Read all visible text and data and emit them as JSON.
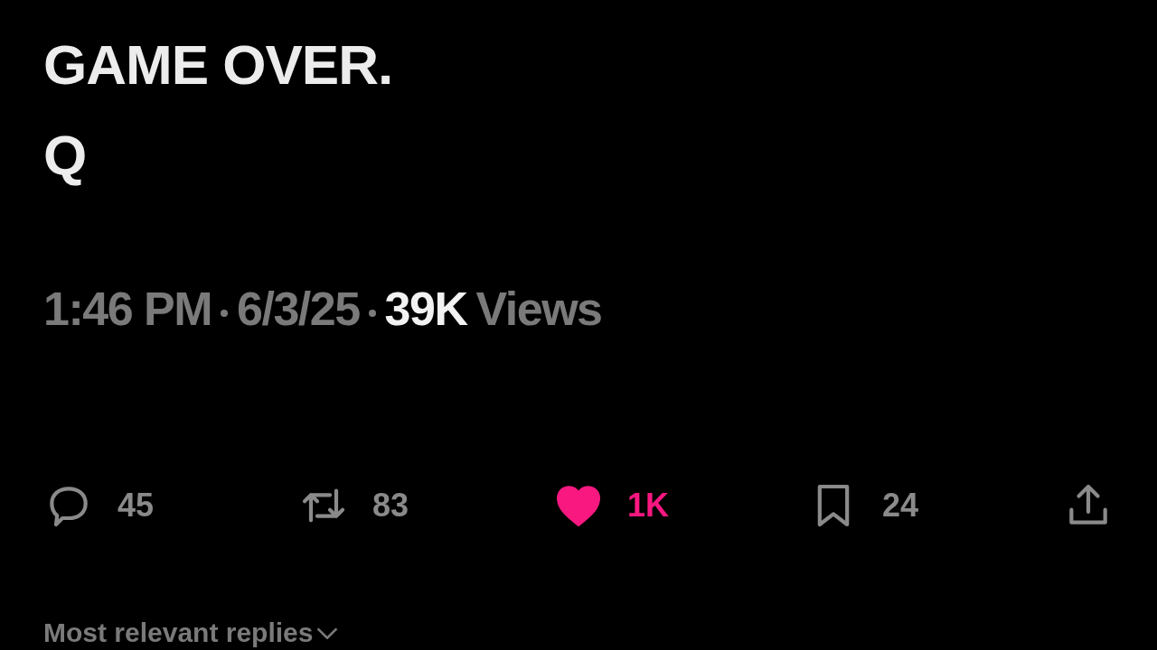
{
  "post": {
    "text_lines": [
      "GAME OVER.",
      "Q"
    ]
  },
  "meta": {
    "time": "1:46 PM",
    "date": "6/3/25",
    "views_count": "39K",
    "views_label": "Views"
  },
  "actions": [
    {
      "kind": "reply",
      "count": "45",
      "active": false
    },
    {
      "kind": "repost",
      "count": "83",
      "active": false
    },
    {
      "kind": "like",
      "count": "1K",
      "active": true
    },
    {
      "kind": "bookmark",
      "count": "24",
      "active": false
    },
    {
      "kind": "share",
      "active": false
    }
  ],
  "replies_sort": {
    "label": "Most relevant replies"
  }
}
